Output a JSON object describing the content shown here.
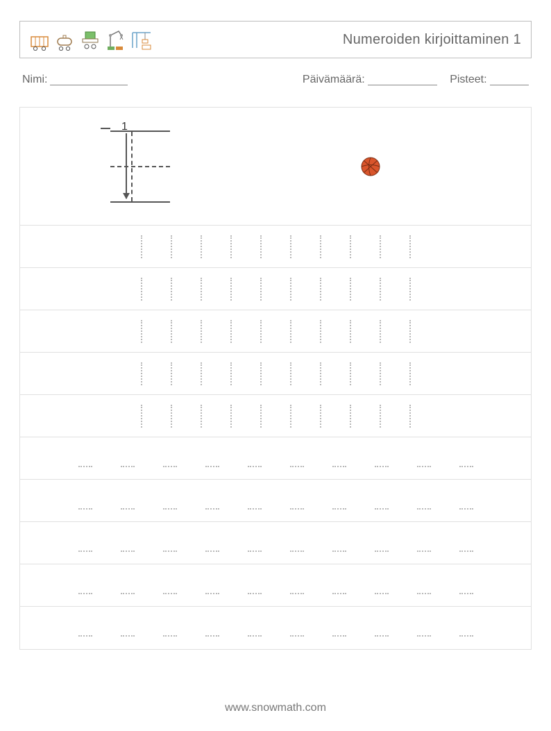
{
  "header": {
    "title": "Numeroiden kirjoittaminen 1"
  },
  "meta": {
    "name_label": "Nimi:",
    "date_label": "Päivämäärä:",
    "score_label": "Pisteet:"
  },
  "demo": {
    "number_label": "1"
  },
  "worksheet": {
    "trace_rows": 5,
    "blank_rows": 5,
    "cells_per_row": 10
  },
  "footer": {
    "url": "www.snowmath.com"
  }
}
